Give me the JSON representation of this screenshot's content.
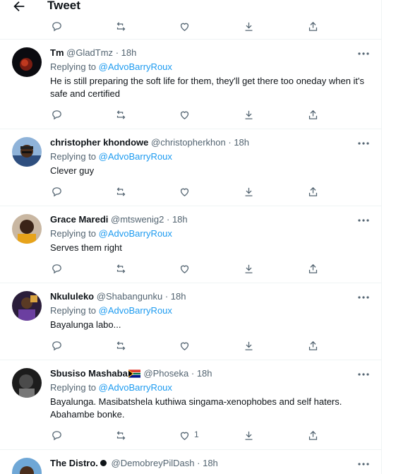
{
  "header": {
    "title": "Tweet"
  },
  "tweets": [
    {
      "name": "Tm",
      "handle": "@GladTmz",
      "time": "18h",
      "replying_prefix": "Replying to",
      "replying_to": "@AdvoBarryRoux",
      "text": "He is still preparing the soft life for them, they'll get there too oneday when it's safe and certified",
      "like_count": ""
    },
    {
      "name": "christopher khondowe",
      "handle": "@christopherkhon",
      "time": "18h",
      "replying_prefix": "Replying to",
      "replying_to": "@AdvoBarryRoux",
      "text": "Clever guy",
      "like_count": ""
    },
    {
      "name": "Grace Maredi",
      "handle": "@mtswenig2",
      "time": "18h",
      "replying_prefix": "Replying to",
      "replying_to": "@AdvoBarryRoux",
      "text": "Serves them right",
      "like_count": ""
    },
    {
      "name": "Nkululeko",
      "handle": "@Shabangunku",
      "time": "18h",
      "replying_prefix": "Replying to",
      "replying_to": "@AdvoBarryRoux",
      "text": "Bayalunga labo...",
      "like_count": ""
    },
    {
      "name": "Sbusiso Mashaba",
      "handle": "@Phoseka",
      "time": "18h",
      "replying_prefix": "Replying to",
      "replying_to": "@AdvoBarryRoux",
      "text": "Bayalunga. Masibatshela kuthiwa singama-xenophobes and self haters. Abahambe bonke.",
      "like_count": "1"
    },
    {
      "name": "The Distro.",
      "handle": "@DemobreyPilDash",
      "time": "18h"
    }
  ],
  "icons": {
    "back": "arrow-left-icon",
    "reply": "reply-icon",
    "retweet": "retweet-icon",
    "like": "heart-icon",
    "bookmark": "bookmark-down-icon",
    "share": "share-icon",
    "more": "more-icon"
  },
  "colors": {
    "link": "#1d9bf0",
    "muted": "#536471",
    "text": "#0f1419",
    "border": "#eff3f4"
  }
}
